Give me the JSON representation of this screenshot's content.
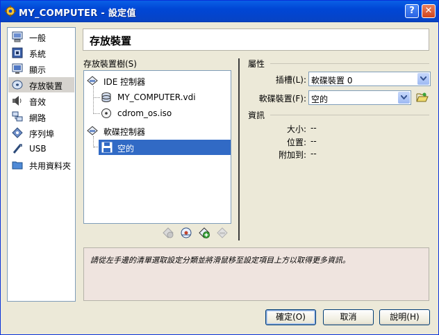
{
  "window": {
    "title": "MY_COMPUTER - 設定值",
    "help_glyph": "?",
    "close_glyph": "✕"
  },
  "sidebar": {
    "items": [
      {
        "label": "一般",
        "icon": "monitor-icon",
        "selected": false
      },
      {
        "label": "系統",
        "icon": "system-board-icon",
        "selected": false
      },
      {
        "label": "顯示",
        "icon": "display-icon",
        "selected": false
      },
      {
        "label": "存放裝置",
        "icon": "disk-icon",
        "selected": true
      },
      {
        "label": "音效",
        "icon": "speaker-icon",
        "selected": false
      },
      {
        "label": "網路",
        "icon": "network-icon",
        "selected": false
      },
      {
        "label": "序列埠",
        "icon": "serial-port-icon",
        "selected": false
      },
      {
        "label": "USB",
        "icon": "usb-icon",
        "selected": false
      },
      {
        "label": "共用資料夾",
        "icon": "folder-icon",
        "selected": false
      }
    ]
  },
  "page": {
    "title": "存放裝置"
  },
  "tree": {
    "label": "存放裝置樹(S)",
    "controllers": [
      {
        "label": "IDE 控制器",
        "children": [
          {
            "label": "MY_COMPUTER.vdi",
            "icon": "hard-disk-icon"
          },
          {
            "label": "cdrom_os.iso",
            "icon": "cd-icon"
          }
        ]
      },
      {
        "label": "軟碟控制器",
        "children": [
          {
            "label": "空的",
            "icon": "floppy-icon",
            "selected": true
          }
        ]
      }
    ]
  },
  "attributes": {
    "group_label": "屬性",
    "slot_label": "插槽(L):",
    "slot_value": "軟碟裝置 0",
    "device_label": "軟碟裝置(F):",
    "device_value": "空的"
  },
  "information": {
    "group_label": "資訊",
    "size_label": "大小:",
    "size_value": "--",
    "location_label": "位置:",
    "location_value": "--",
    "attached_label": "附加到:",
    "attached_value": "--"
  },
  "info_text": "請從左手邊的清單選取設定分類並將滑鼠移至設定項目上方以取得更多資訊。",
  "buttons": {
    "ok": "確定(O)",
    "cancel": "取消",
    "help": "說明(H)"
  },
  "colors": {
    "selection": "#316ac5",
    "titlebar": "#0046d5",
    "info_bg": "#efe4df"
  }
}
